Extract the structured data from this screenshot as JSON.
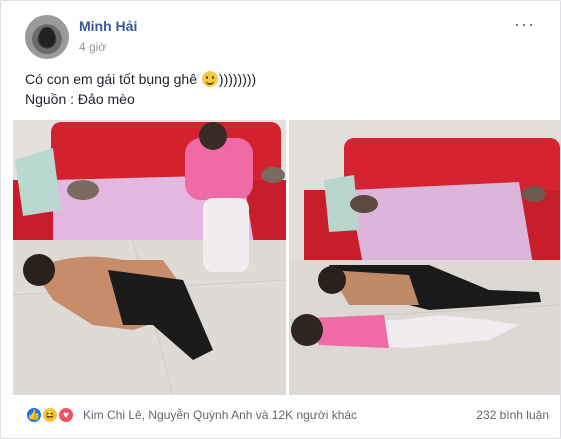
{
  "post": {
    "author": "Minh Hải",
    "time": "4 giờ",
    "text_line1": "Có con em gái tốt bụng ghê",
    "text_line1_suffix": "))))))))",
    "text_line2": "Nguồn : Đảo mèo"
  },
  "icons": {
    "more": "more-horizontal-icon",
    "emoji": "smile-emoji-icon",
    "like": "like-reaction-icon",
    "haha": "haha-reaction-icon",
    "love": "love-reaction-icon"
  },
  "footer": {
    "reaction_names": "Kim Chi Lê, Nguyễn Quỳnh Anh và 12K người khác",
    "comments": "232 bình luận"
  },
  "colors": {
    "name_link": "#365899",
    "meta": "#90949c",
    "like": "#1877f2",
    "love": "#f25268",
    "haha": "#f7c948"
  }
}
